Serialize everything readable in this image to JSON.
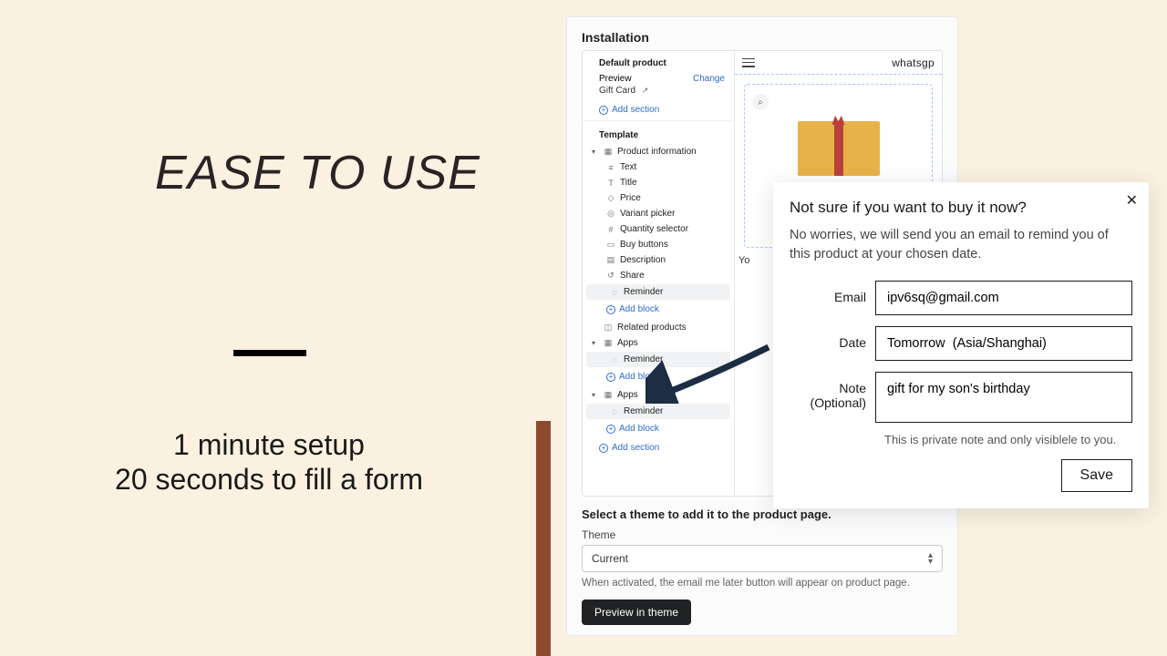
{
  "marketing": {
    "headline": "EASE TO USE",
    "sub1": "1 minute setup",
    "sub2": "20 seconds to fill a form"
  },
  "installer": {
    "title": "Installation",
    "default_product_label": "Default product",
    "preview_label": "Preview",
    "change_label": "Change",
    "gift_card_label": "Gift Card",
    "add_section_label": "Add section",
    "template_label": "Template",
    "product_information_label": "Product information",
    "items": {
      "text": "Text",
      "title": "Title",
      "price": "Price",
      "variant_picker": "Variant picker",
      "quantity_selector": "Quantity selector",
      "buy_buttons": "Buy buttons",
      "description": "Description",
      "share": "Share",
      "reminder": "Reminder"
    },
    "add_block_label": "Add block",
    "related_products_label": "Related products",
    "apps_label": "Apps",
    "preview_brand": "whatsgp",
    "preview_yo": "Yo",
    "select_theme_heading": "Select a theme to add it to the product page.",
    "theme_label": "Theme",
    "theme_value": "Current",
    "theme_hint": "When activated, the email me later button will appear on product page.",
    "preview_in_theme_label": "Preview in theme"
  },
  "popup": {
    "title": "Not sure if you want to buy it now?",
    "lead": "No worries, we will send you an email to remind you of this product at your chosen date.",
    "email_label": "Email",
    "email_value": "ipv6sq@gmail.com",
    "date_label": "Date",
    "date_value": "Tomorrow  (Asia/Shanghai)",
    "note_label": "Note",
    "note_optional": "(Optional)",
    "note_value": "gift for my son's birthday",
    "note_help": "This is private note and only visiblele to you.",
    "save_label": "Save"
  }
}
